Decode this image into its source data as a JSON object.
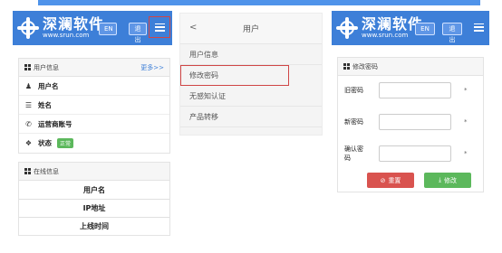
{
  "colors": {
    "brand": "#3d7fd8",
    "accent_bar": "#4f93ea",
    "highlight": "#d04646",
    "danger": "#d9534f",
    "success": "#5cb85c"
  },
  "brand": {
    "name_cn": "深澜软件",
    "name_en": "www.srun.com"
  },
  "left": {
    "header": {
      "lang_label": "EN",
      "logout_label": "退出"
    },
    "user_card": {
      "title": "用户信息",
      "more": "更多>>",
      "rows": [
        {
          "icon": "user-icon",
          "label": "用户名"
        },
        {
          "icon": "list-icon",
          "label": "姓名"
        },
        {
          "icon": "phone-icon",
          "label": "运营商账号"
        },
        {
          "icon": "info-icon",
          "label": "状态",
          "badge": "正常"
        }
      ]
    },
    "online_card": {
      "title": "在线信息",
      "rows": [
        "用户名",
        "IP地址",
        "上线时间"
      ]
    }
  },
  "middle": {
    "title": "用户",
    "back": "<",
    "items": [
      "用户信息",
      "修改密码",
      "无感知认证",
      "产品转移"
    ],
    "selected_index": 1
  },
  "right": {
    "header": {
      "lang_label": "EN",
      "logout_label": "退出"
    },
    "form": {
      "title": "修改密码",
      "fields": [
        {
          "label": "旧密码",
          "required": "*"
        },
        {
          "label": "新密码",
          "required": "*"
        },
        {
          "label": "确认密码",
          "required": "*"
        }
      ],
      "reset_label": "重置",
      "save_label": "修改"
    }
  }
}
